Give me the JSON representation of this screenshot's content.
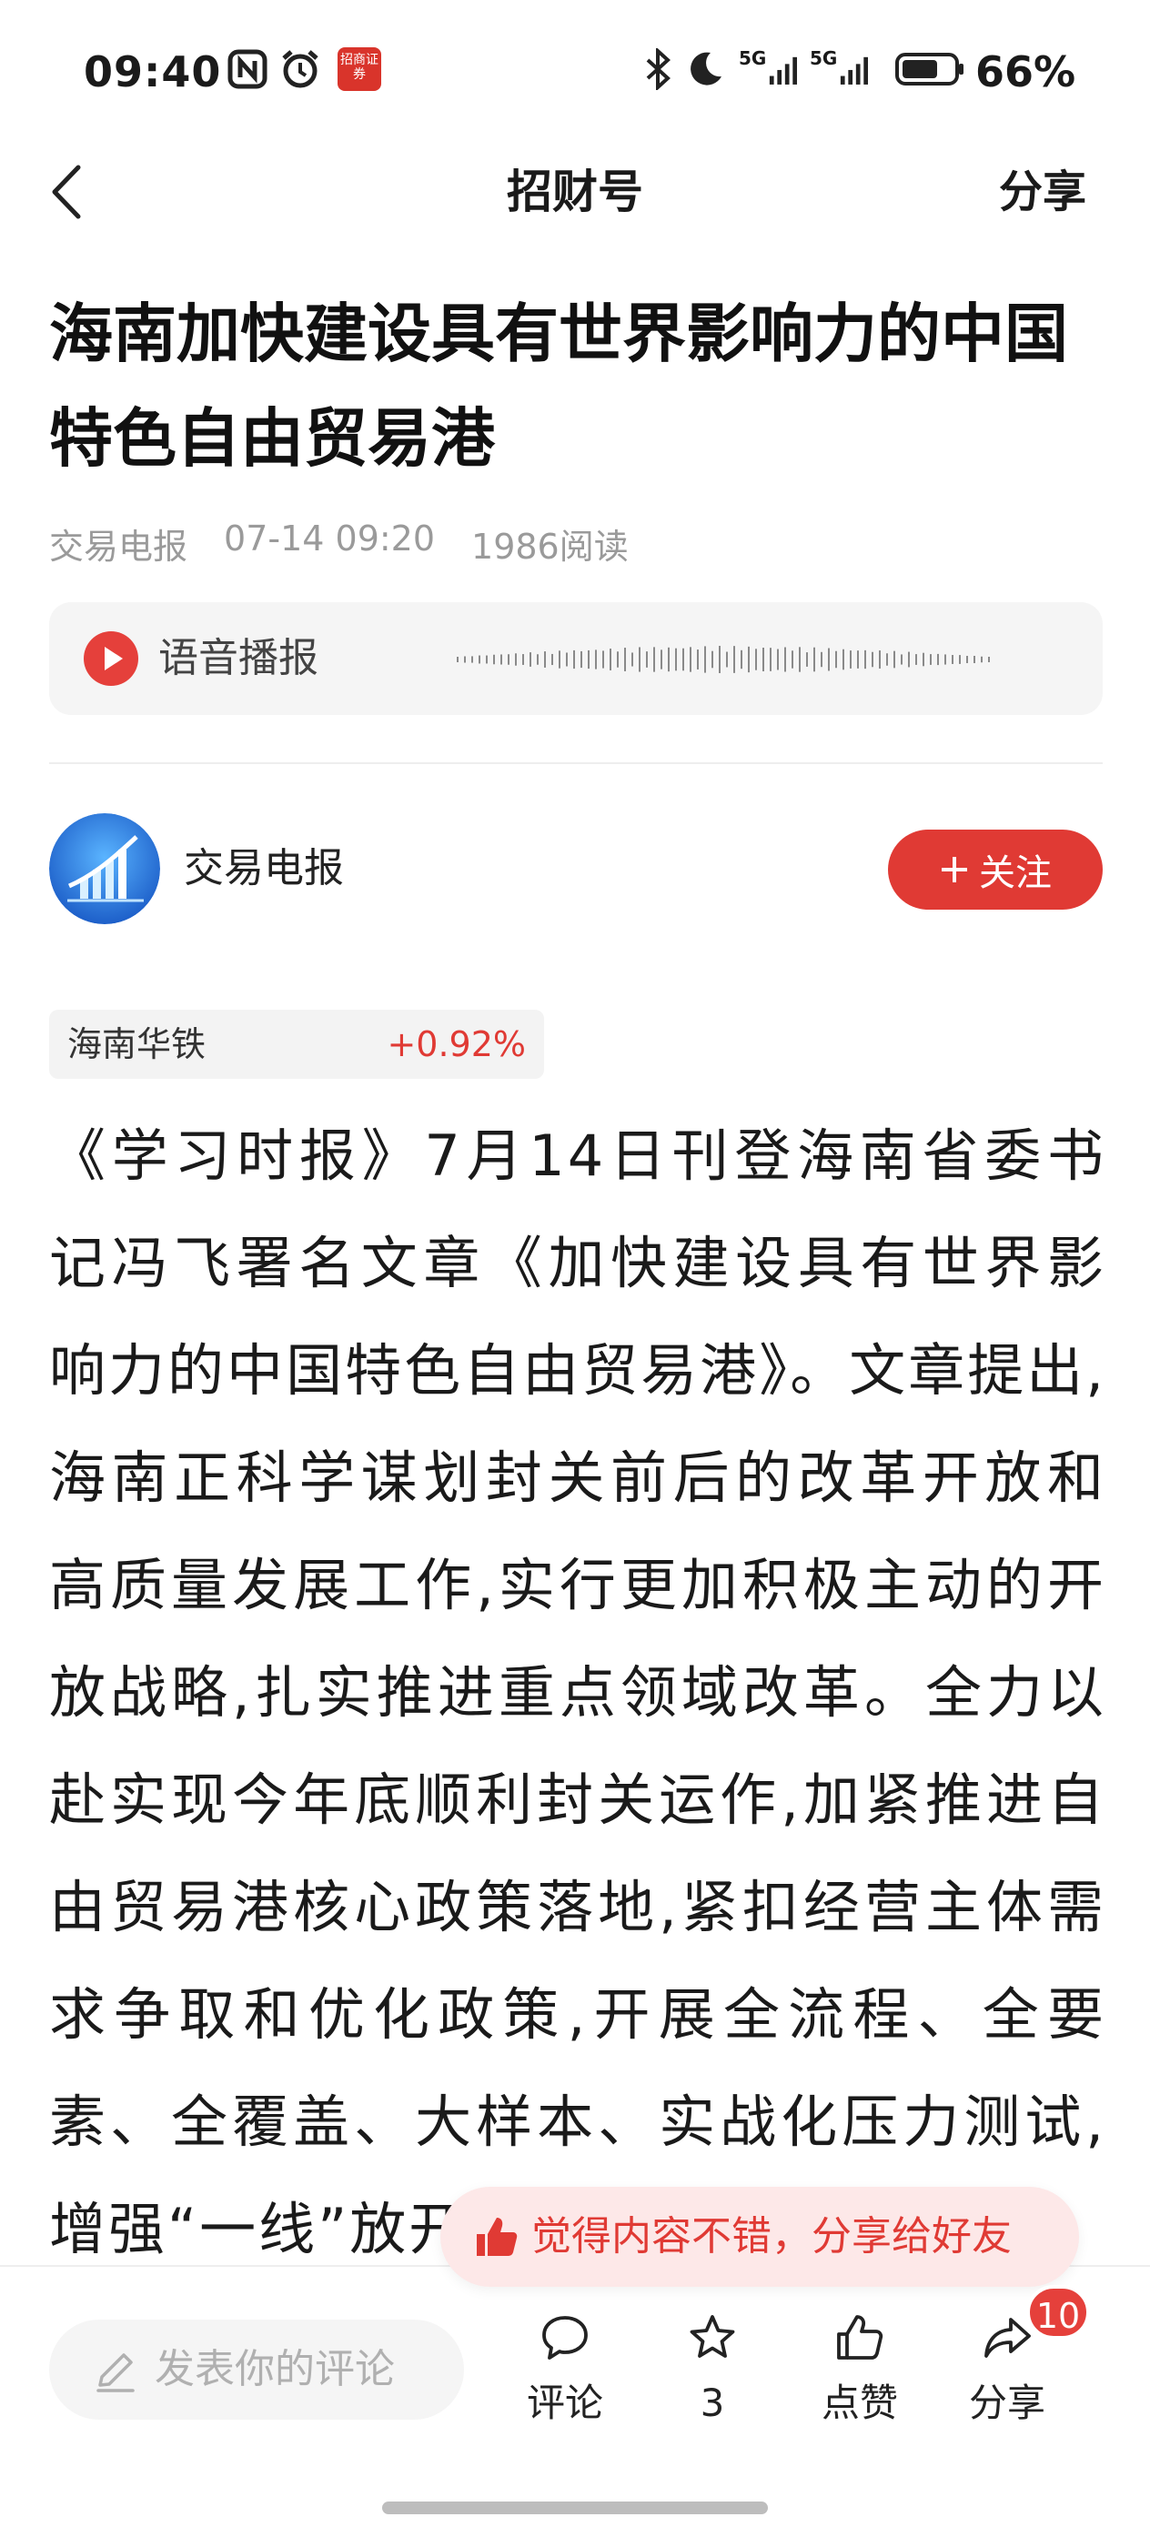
{
  "status_bar": {
    "time": "09:40",
    "app_badge_text": "招商证券",
    "network_1": "5G",
    "network_2": "5G",
    "battery": "66%"
  },
  "nav": {
    "title": "招财号",
    "share": "分享"
  },
  "article": {
    "title": "海南加快建设具有世界影响力的中国特色自由贸易港",
    "source": "交易电报",
    "datetime": "07-14 09:20",
    "reads": "1986阅读",
    "body": "《学习时报》7月14日刊登海南省委书记冯飞署名文章《加快建设具有世界影响力的中国特色自由贸易港》。文章提出,海南正科学谋划封关前后的改革开放和高质量发展工作,实行更加积极主动的开放战略,扎实推进重点领域改革。全力以赴实现今年底顺利封关运作,加紧推进自由贸易港核心政策落地,紧扣经营主体需求争取和优化政策,开展全流程、全要素、全覆盖、大样本、实战化压力测试,增强“一线”放开、“二线”管住的能力"
  },
  "audio": {
    "label": "语音播报"
  },
  "author": {
    "name": "交易电报",
    "follow_label": "关注"
  },
  "stock": {
    "name": "海南华铁",
    "change": "+0.92%"
  },
  "share_hint": {
    "text": "觉得内容不错，分享给好友"
  },
  "bottom_bar": {
    "comment_placeholder": "发表你的评论",
    "comment_label": "评论",
    "favorite_count": "3",
    "like_label": "点赞",
    "share_label": "分享",
    "share_badge": "10"
  },
  "colors": {
    "accent": "#e03a34",
    "hint_bg": "#fde8e8",
    "meta_gray": "#9a9a9a"
  }
}
